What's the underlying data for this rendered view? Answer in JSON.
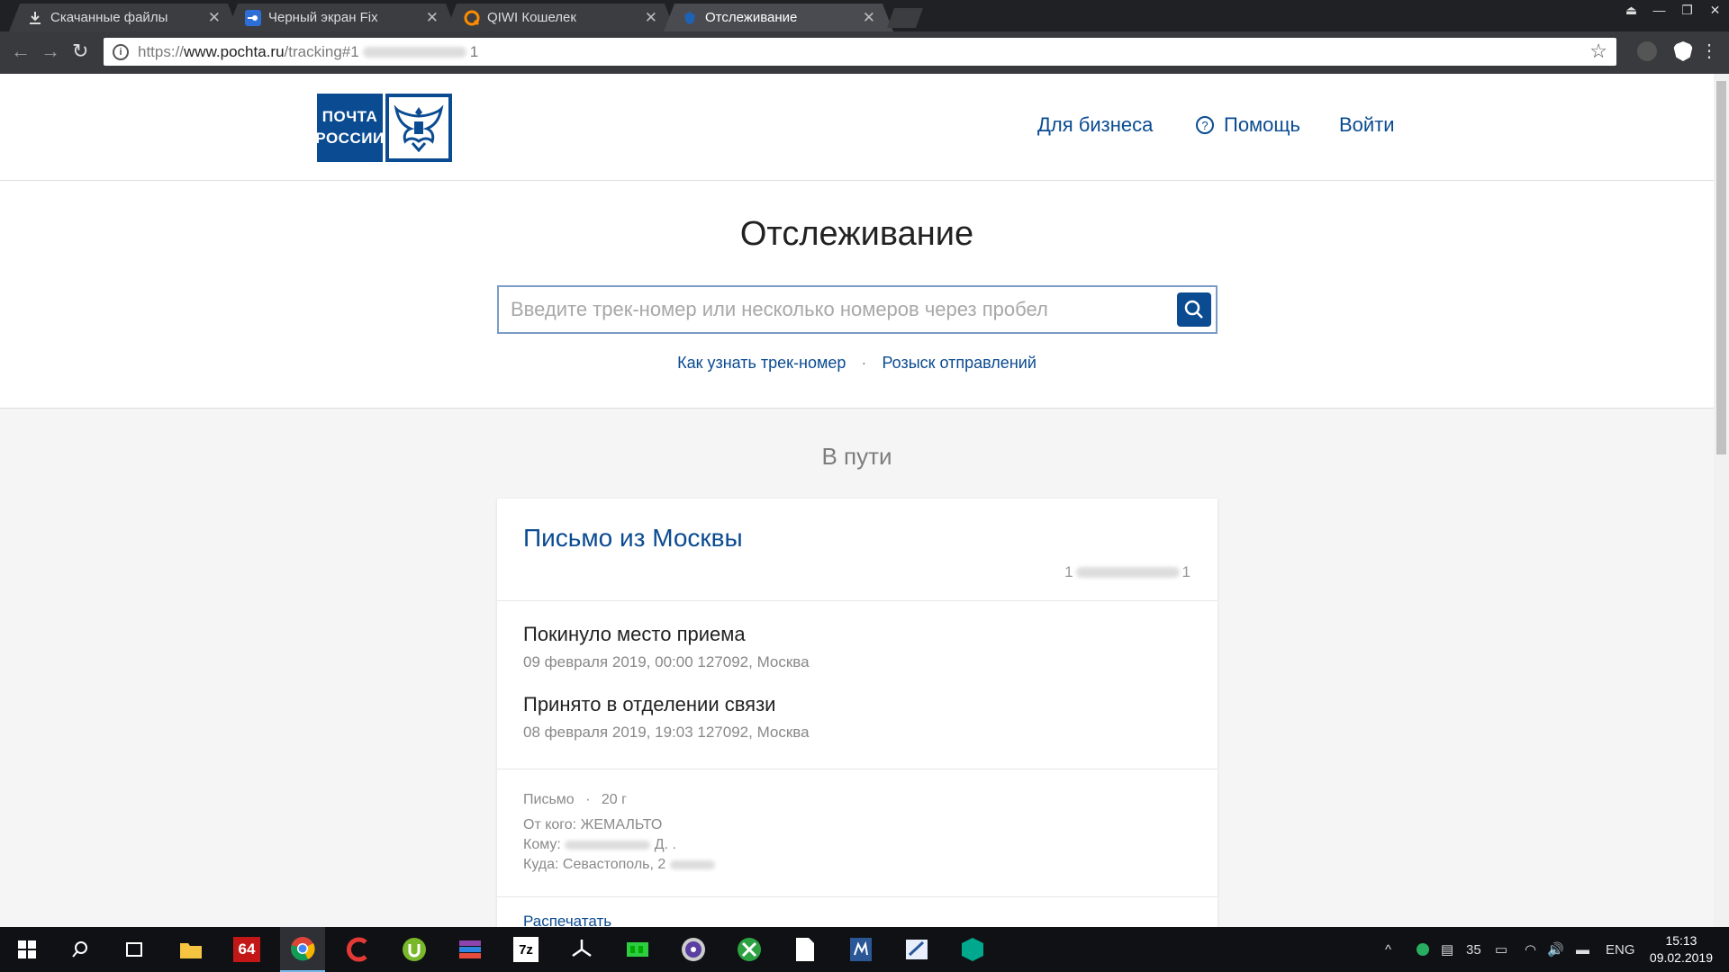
{
  "browser": {
    "tabs": [
      {
        "title": "Скачанные файлы",
        "icon": "download-icon",
        "active": false
      },
      {
        "title": "Черный экран Fix",
        "icon": "tab-favicon-blue",
        "active": false
      },
      {
        "title": "QIWI Кошелек",
        "icon": "qiwi-icon",
        "active": false
      },
      {
        "title": "Отслеживание",
        "icon": "pochta-favicon",
        "active": true
      }
    ],
    "url": {
      "protocol": "https://",
      "host": "www.pochta.ru",
      "path": "/tracking#1",
      "suffix": "1"
    }
  },
  "site": {
    "logo": {
      "line1": "ПОЧТА",
      "line2": "РОССИИ"
    },
    "nav": {
      "business": "Для бизнеса",
      "help": "Помощь",
      "login": "Войти"
    },
    "page_title": "Отслеживание",
    "search_placeholder": "Введите трек-номер или несколько номеров через пробел",
    "search_value": "",
    "link_how": "Как узнать трек-номер",
    "link_sep": "·",
    "link_search": "Розыск отправлений",
    "status": "В пути"
  },
  "parcel": {
    "title": "Письмо из Москвы",
    "track_prefix": "1",
    "track_suffix": "1",
    "events": [
      {
        "name": "Покинуло место приема",
        "detail": "09 февраля 2019, 00:00 127092, Москва"
      },
      {
        "name": "Принято в отделении связи",
        "detail": "08 февраля 2019, 19:03 127092, Москва"
      }
    ],
    "type": "Письмо",
    "type_sep": "·",
    "weight": "20 г",
    "from": "От кого: ЖЕМАЛЬТО",
    "to_label": "Кому:",
    "to_initials": "Д. .",
    "where": "Куда: Севастополь, 2",
    "print": "Распечатать"
  },
  "taskbar": {
    "apps": [
      "windows-start-icon",
      "search-icon",
      "task-view-icon",
      "file-explorer-icon",
      "aida64-icon",
      "chrome-icon",
      "ccleaner-icon",
      "utorrent-icon",
      "winrar-icon",
      "7zip-icon",
      "fan-icon",
      "gpu-tool-icon",
      "disc-icon",
      "xbox-icon",
      "document-icon",
      "ms-app-icon",
      "paint-icon",
      "security-icon"
    ],
    "tray_temp": "35",
    "lang": "ENG",
    "time": "15:13",
    "date": "09.02.2019"
  }
}
